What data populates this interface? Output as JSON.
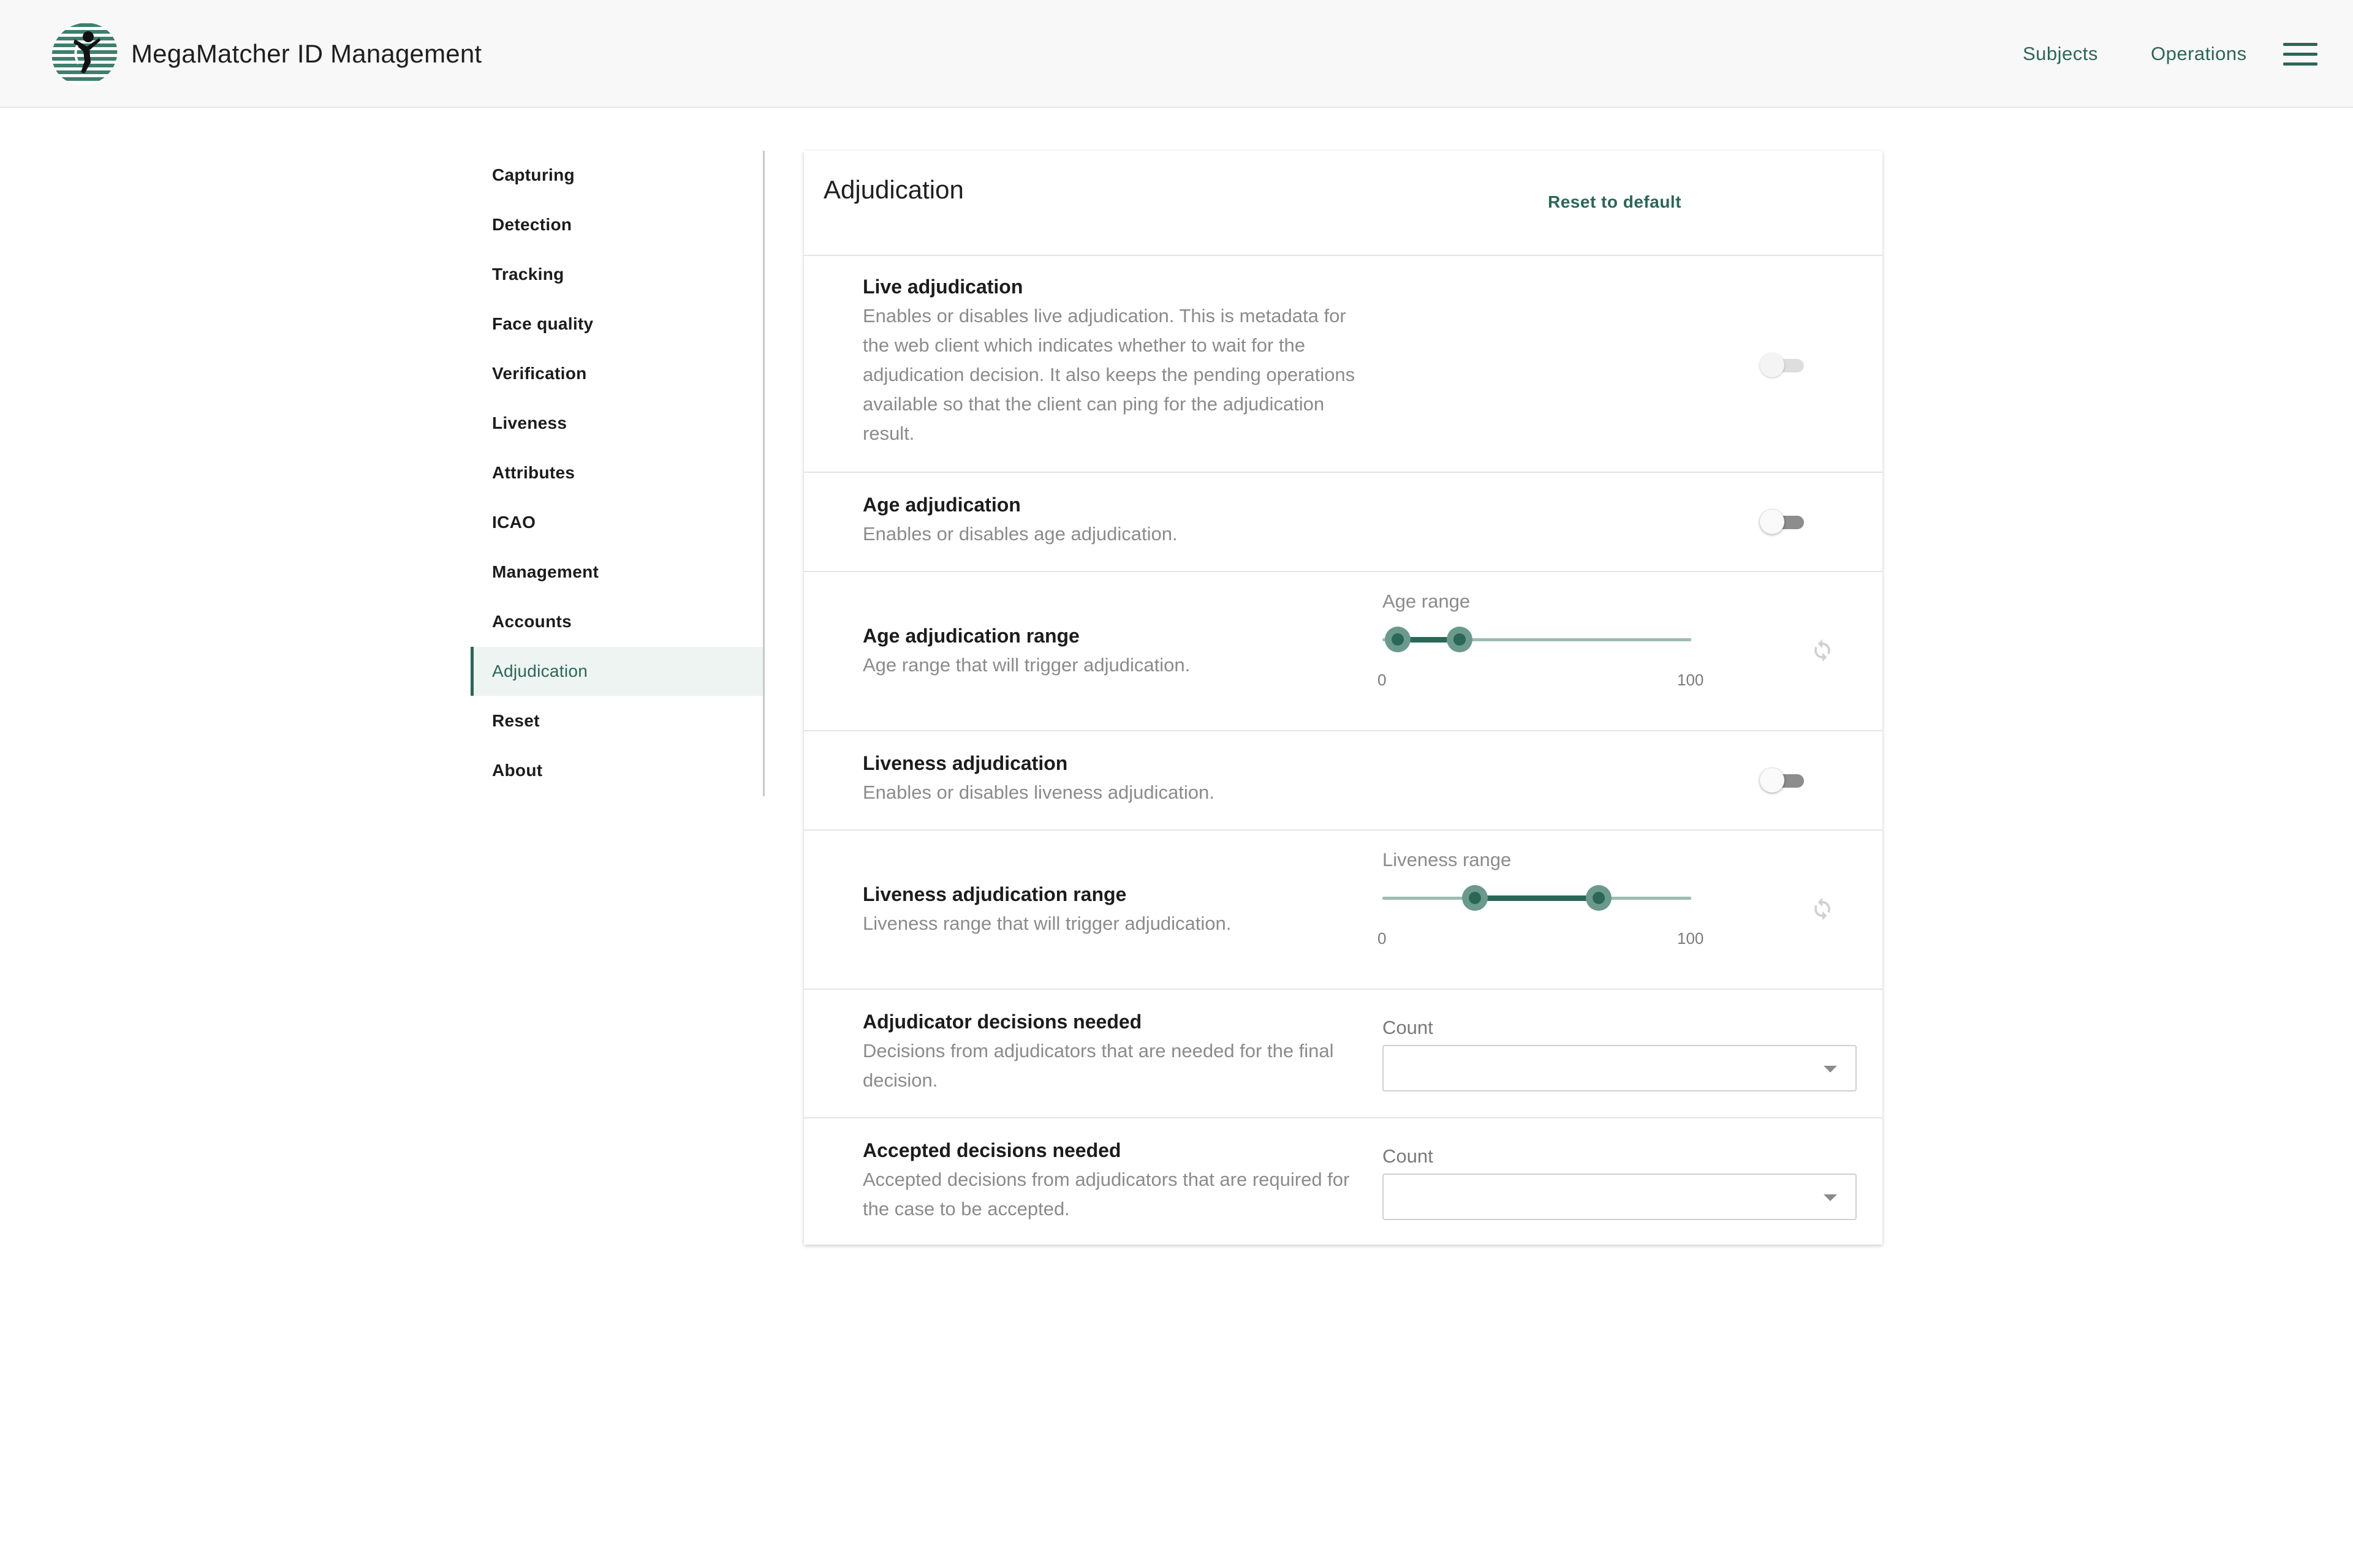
{
  "app": {
    "title": "MegaMatcher ID Management",
    "nav": {
      "subjects": "Subjects",
      "operations": "Operations"
    },
    "accent_color": "#2b6657"
  },
  "sidebar": {
    "items": [
      {
        "label": "Capturing"
      },
      {
        "label": "Detection"
      },
      {
        "label": "Tracking"
      },
      {
        "label": "Face quality"
      },
      {
        "label": "Verification"
      },
      {
        "label": "Liveness"
      },
      {
        "label": "Attributes"
      },
      {
        "label": "ICAO"
      },
      {
        "label": "Management"
      },
      {
        "label": "Accounts"
      },
      {
        "label": "Adjudication",
        "active": true
      },
      {
        "label": "Reset"
      },
      {
        "label": "About"
      }
    ]
  },
  "card": {
    "title": "Adjudication",
    "reset_label": "Reset to default",
    "settings": {
      "live": {
        "title": "Live adjudication",
        "description": "Enables or disables live adjudication. This is metadata for the web client which indicates whether to wait for the adjudication decision. It also keeps the pending operations available so that the client can ping for the adjudication result.",
        "enabled": false,
        "disabled": true
      },
      "age": {
        "title": "Age adjudication",
        "description": "Enables or disables age adjudication.",
        "enabled": false
      },
      "age_range": {
        "title": "Age adjudication range",
        "description": "Age range that will trigger adjudication.",
        "slider_label": "Age range",
        "min_label": "0",
        "max_label": "100",
        "min": 0,
        "max": 100,
        "low": 5,
        "high": 25
      },
      "liveness": {
        "title": "Liveness adjudication",
        "description": "Enables or disables liveness adjudication.",
        "enabled": false
      },
      "liveness_range": {
        "title": "Liveness adjudication range",
        "description": "Liveness range that will trigger adjudication.",
        "slider_label": "Liveness range",
        "min_label": "0",
        "max_label": "100",
        "min": 0,
        "max": 100,
        "low": 30,
        "high": 70
      },
      "adjudicator_decisions": {
        "title": "Adjudicator decisions needed",
        "description": "Decisions from adjudicators that are needed for the final decision.",
        "field_label": "Count",
        "value": ""
      },
      "accepted_decisions": {
        "title": "Accepted decisions needed",
        "description": "Accepted decisions from adjudicators that are required for the case to be accepted.",
        "field_label": "Count",
        "value": ""
      }
    }
  }
}
